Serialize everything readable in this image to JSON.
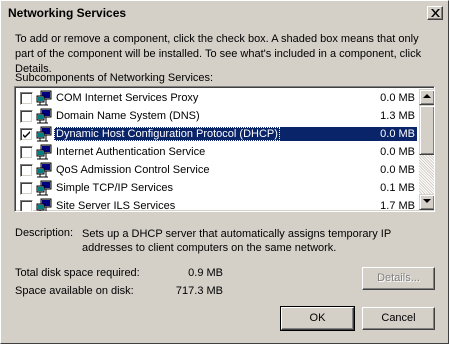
{
  "dialog": {
    "title": "Networking Services",
    "close_icon": "close-x-icon"
  },
  "intro_text": "To add or remove a component, click the check box. A shaded box means that only part of the component will be installed. To see what's included in a component, click Details.",
  "subcomponents": {
    "label": "Subcomponents of Networking Services:",
    "items": [
      {
        "name": "COM Internet Services Proxy",
        "size": "0.0 MB",
        "checked": false,
        "selected": false,
        "icon": "network-component-icon"
      },
      {
        "name": "Domain Name System (DNS)",
        "size": "1.3 MB",
        "checked": false,
        "selected": false,
        "icon": "network-component-icon"
      },
      {
        "name": "Dynamic Host Configuration Protocol (DHCP)",
        "size": "0.0 MB",
        "checked": true,
        "selected": true,
        "icon": "network-component-icon"
      },
      {
        "name": "Internet Authentication Service",
        "size": "0.0 MB",
        "checked": false,
        "selected": false,
        "icon": "network-component-icon"
      },
      {
        "name": "QoS Admission Control Service",
        "size": "0.0 MB",
        "checked": false,
        "selected": false,
        "icon": "network-component-icon"
      },
      {
        "name": "Simple TCP/IP Services",
        "size": "0.1 MB",
        "checked": false,
        "selected": false,
        "icon": "network-component-icon"
      },
      {
        "name": "Site Server ILS Services",
        "size": "1.7 MB",
        "checked": false,
        "selected": false,
        "icon": "network-component-icon"
      }
    ]
  },
  "description": {
    "label": "Description:",
    "text": "Sets up a DHCP server that automatically assigns temporary IP addresses to client computers on the same network."
  },
  "disk": {
    "required_label": "Total disk space required:",
    "required_value": "0.9 MB",
    "available_label": "Space available on disk:",
    "available_value": "717.3 MB"
  },
  "buttons": {
    "details": "Details...",
    "ok": "OK",
    "cancel": "Cancel"
  },
  "colors": {
    "face": "#d4d0c8",
    "selection": "#0a246a"
  }
}
